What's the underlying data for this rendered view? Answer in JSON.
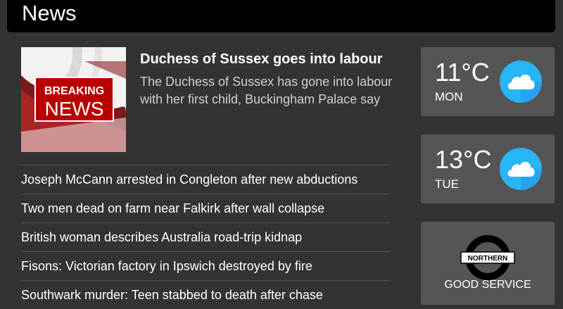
{
  "header": {
    "title": "News"
  },
  "featured": {
    "image_text_1": "BREAKING",
    "image_text_2": "NEWS",
    "headline": "Duchess of Sussex goes into labour",
    "summary": "The Duchess of Sussex has gone into labour with her first child, Buckingham Palace say"
  },
  "news": [
    "Joseph McCann arrested in Congleton after new abductions",
    "Two men dead on farm near Falkirk after wall collapse",
    "British woman describes Australia road-trip kidnap",
    "Fisons: Victorian factory in Ipswich destroyed by fire",
    "Southwark murder: Teen stabbed to death after chase"
  ],
  "weather": [
    {
      "temp": "11°C",
      "day": "MON",
      "icon": "cloud-icon"
    },
    {
      "temp": "13°C",
      "day": "TUE",
      "icon": "cloud-icon"
    }
  ],
  "tfl": {
    "line": "NORTHERN",
    "status": "GOOD SERVICE",
    "icon": "roundel-icon"
  },
  "colors": {
    "background": "#333333",
    "header": "#000000",
    "tile": "#555555",
    "weather_icon": "#29b6f6",
    "breaking_red": "#b80000",
    "roundel_red": "#dc241f"
  }
}
